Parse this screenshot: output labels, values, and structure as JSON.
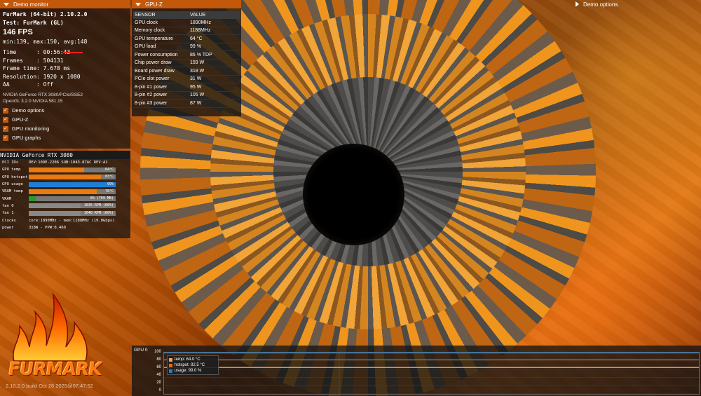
{
  "window": {
    "demo_monitor_title": "Demo monitor",
    "gpuz_title": "GPU-Z",
    "demo_options_title": "Demo options"
  },
  "monitor": {
    "app": "FurMark (64-bit) 2.10.2.0",
    "test": "Test: FurMark (GL)",
    "fps": "146 FPS",
    "fps_stats": "min:139, max:150, avg:148",
    "time_label": "Time",
    "time_value": "00:56:43",
    "frames_label": "Frames",
    "frames_value": "504131",
    "frametime_label": "Frame time",
    "frametime_value": "7.678 ms",
    "resolution_label": "Resolution",
    "resolution_value": "1920 x 1080",
    "aa_label": "AA",
    "aa_value": "Off",
    "gpu_line": "NVIDIA GeForce RTX 3080/PCIe/SSE2",
    "gl_line": "OpenGL 3.2.0 NVIDIA 581.15",
    "checkboxes": [
      "Demo options",
      "GPU-Z",
      "GPU monitoring",
      "GPU graphs"
    ]
  },
  "gpuz": {
    "header": [
      "SENSOR",
      "VALUE"
    ],
    "rows": [
      [
        "GPU clock",
        "1890MHz"
      ],
      [
        "Memory clock",
        "1188MHz"
      ],
      [
        "GPU temperature",
        "64 °C"
      ],
      [
        "GPU load",
        "99 %"
      ],
      [
        "Power consumption",
        "86 % TDP"
      ],
      [
        "Chip power draw",
        "159 W"
      ],
      [
        "Board power draw",
        "318 W"
      ],
      [
        "PCIe slot power",
        "31 W"
      ],
      [
        "8-pin #1 power",
        "95 W"
      ],
      [
        "8-pin #2 power",
        "105 W"
      ],
      [
        "8-pin #3 power",
        "87 W"
      ]
    ]
  },
  "rtx": {
    "title": "NVIDIA GeForce RTX 3080",
    "pci_label": "PCI IDs",
    "pci_value": "DEV:10DE-2206 SUB:1043-87AC REV:A1",
    "bars": [
      {
        "label": "GPU temp",
        "text": "64°C",
        "fill": 0.64,
        "color": "#e87a10"
      },
      {
        "label": "GPU hotspot",
        "text": "83°C",
        "fill": 0.83,
        "color": "#e87a10"
      },
      {
        "label": "GPU usage",
        "text": "99%",
        "fill": 0.99,
        "color": "#1e7fd6"
      },
      {
        "label": "VRAM temp",
        "text": "78°C",
        "fill": 0.78,
        "color": "#e87a10"
      },
      {
        "label": "VRAM",
        "text": "8% (769 MB)",
        "fill": 0.08,
        "color": "#2a9a2a"
      },
      {
        "label": "fan 0",
        "text": "1635 RPM (60%)",
        "fill": 0.6,
        "color": "#888888"
      },
      {
        "label": "fan 1",
        "text": "1640 RPM (60%)",
        "fill": 0.6,
        "color": "#888888"
      }
    ],
    "clocks_label": "Clocks",
    "clocks_value": "core:1890MHz - mem:1188MHz (19.0Gbps)",
    "power_label": "power",
    "power_value": "318W - PPW:0.460"
  },
  "logo": {
    "text": "FURMARK",
    "build": "2.10.2.0 build Oct 26 2025@07:47:52"
  },
  "chart_data": {
    "type": "line",
    "title": "GPU 0",
    "ylim": [
      0,
      100
    ],
    "yticks": [
      "100",
      "80",
      "60",
      "40",
      "20",
      "0"
    ],
    "series": [
      {
        "name": "temp: 64.0 °C",
        "value": 64.0,
        "color": "#e8a860"
      },
      {
        "name": "hotspot: 82.5 °C",
        "value": 82.5,
        "color": "#e86a10"
      },
      {
        "name": "usage: 99.0 %",
        "value": 99.0,
        "color": "#1e7fd6"
      }
    ]
  }
}
